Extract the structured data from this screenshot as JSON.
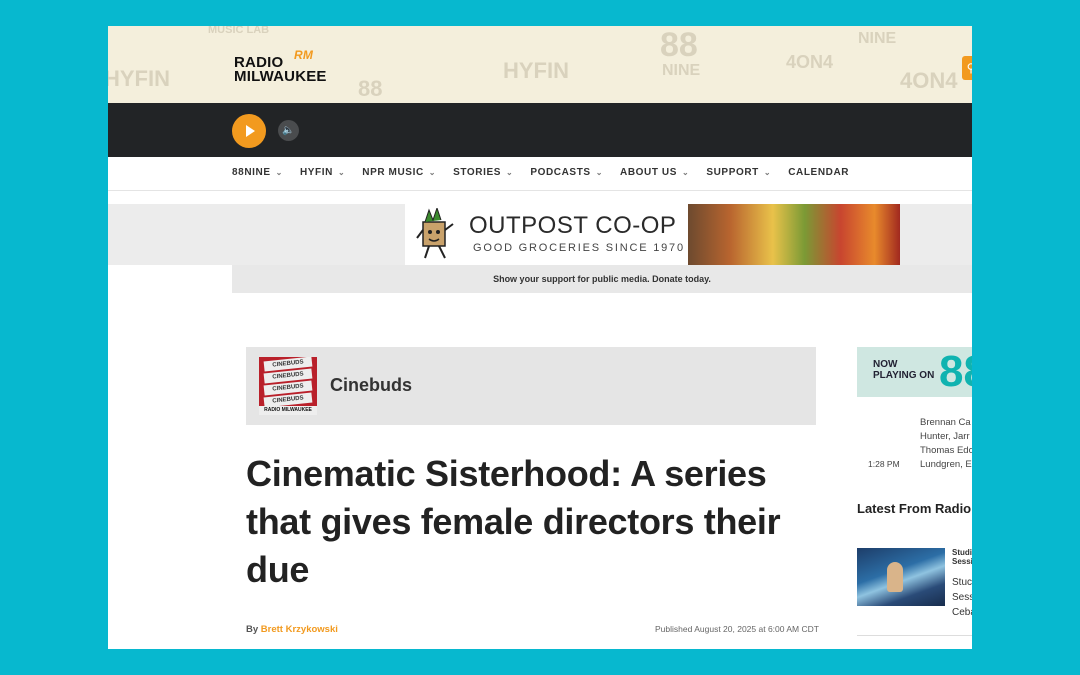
{
  "header": {
    "logo_line1": "RADIO",
    "logo_line2": "MILWAUKEE",
    "logo_mark": "RM",
    "pattern_words": [
      "HYFIN",
      "88",
      "NINE",
      "4ON4",
      "MUSIC LAB",
      "HYFIN",
      "88",
      "NINE",
      "4ON4"
    ],
    "search_icon": "search-icon"
  },
  "player": {
    "play_icon": "play-icon",
    "volume_icon": "volume-icon"
  },
  "nav": {
    "items": [
      {
        "label": "88NINE",
        "dropdown": true
      },
      {
        "label": "HYFIN",
        "dropdown": true
      },
      {
        "label": "NPR MUSIC",
        "dropdown": true
      },
      {
        "label": "STORIES",
        "dropdown": true
      },
      {
        "label": "PODCASTS",
        "dropdown": true
      },
      {
        "label": "ABOUT US",
        "dropdown": true
      },
      {
        "label": "SUPPORT",
        "dropdown": true
      },
      {
        "label": "CALENDAR",
        "dropdown": false
      }
    ]
  },
  "ad": {
    "title": "OUTPOST CO-OP",
    "tagline": "GOOD GROCERIES SINCE 1970"
  },
  "donate": {
    "text": "Show your support for public media. Donate today."
  },
  "program": {
    "name": "Cinebuds",
    "thumb_tickets": [
      "CINEBUDS",
      "CINEBUDS",
      "CINEBUDS",
      "CINEBUDS"
    ],
    "thumb_footer": "RADIO MILWAUKEE"
  },
  "article": {
    "title": "Cinematic Sisterhood: A series that gives female directors their due",
    "by_prefix": "By",
    "author": "Brett Krzykowski",
    "published": "Published August 20, 2025 at 6:00 AM CDT"
  },
  "sidebar": {
    "now_playing_line1": "NOW",
    "now_playing_line2": "PLAYING ON",
    "now_playing_station": "88",
    "time": "1:28 PM",
    "artists": [
      "Brennan Ca",
      "Hunter, Jarr",
      "Thomas Edo",
      "Lundgren, E"
    ],
    "latest_heading": "Latest From Radio M",
    "story_category_line1": "Studi",
    "story_category_line2": "Sessi",
    "story_title_lines": [
      "Stuc",
      "Sess",
      "Ceba"
    ]
  },
  "colors": {
    "accent": "#f29a1f",
    "background": "#07b8cf",
    "player_bar": "#222426",
    "header_cream": "#f4efdc"
  }
}
